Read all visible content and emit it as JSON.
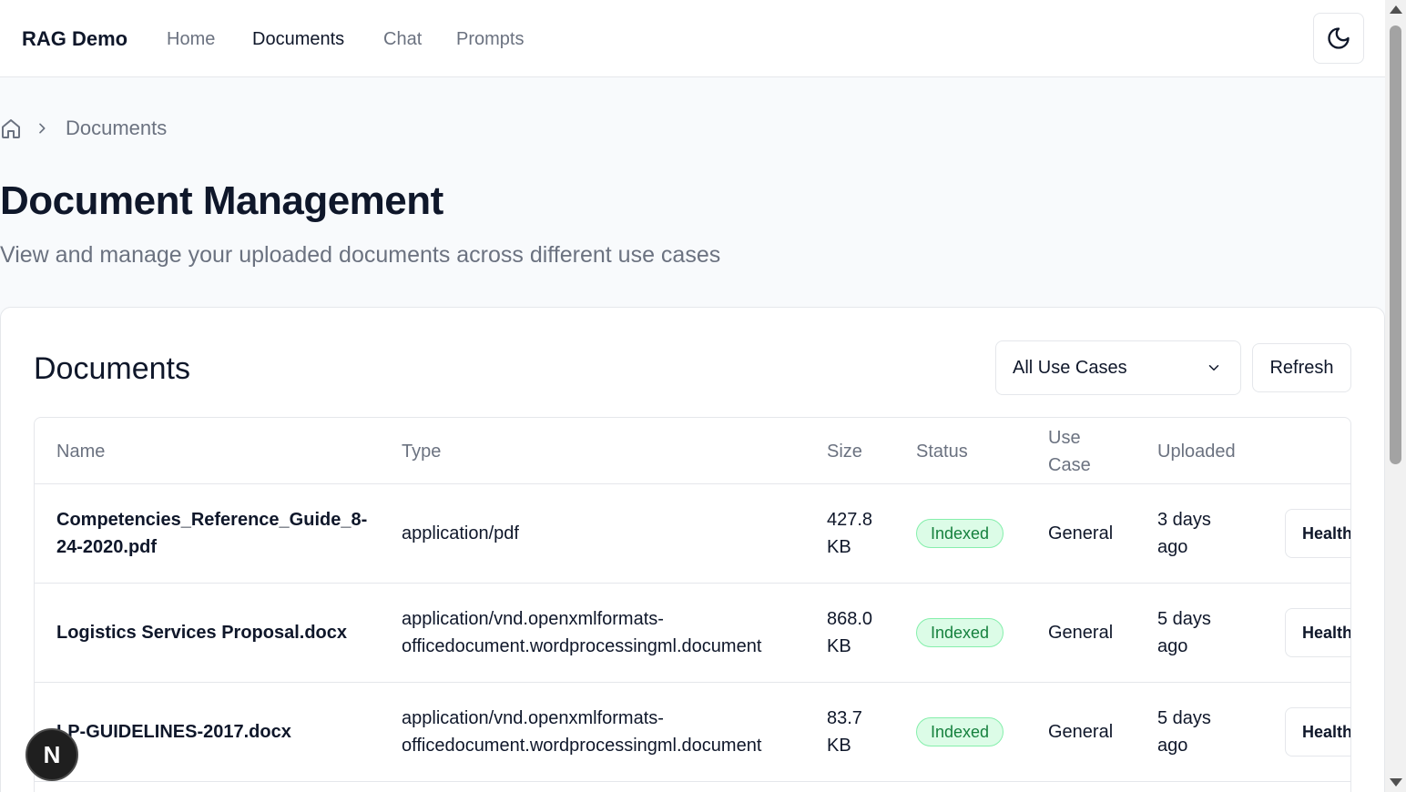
{
  "navbar": {
    "brand": "RAG Demo",
    "links": [
      {
        "label": "Home",
        "active": false
      },
      {
        "label": "Documents",
        "active": true
      },
      {
        "label": "Chat",
        "active": false
      },
      {
        "label": "Prompts",
        "active": false
      }
    ],
    "theme_toggle_icon": "moon-icon"
  },
  "breadcrumb": {
    "home_icon": "home-icon",
    "separator_icon": "chevron-right-icon",
    "current": "Documents"
  },
  "header": {
    "title": "Document Management",
    "subtitle": "View and manage your uploaded documents across different use cases"
  },
  "card": {
    "title": "Documents",
    "filter": {
      "selected": "All Use Cases",
      "icon": "chevron-down-icon"
    },
    "refresh_label": "Refresh"
  },
  "table": {
    "columns": [
      "Name",
      "Type",
      "Size",
      "Status",
      "Use Case",
      "Uploaded"
    ],
    "rows": [
      {
        "name": "Competencies_Reference_Guide_8-24-2020.pdf",
        "type": "application/pdf",
        "size": "427.8 KB",
        "status": "Indexed",
        "use_case": "General",
        "uploaded": "3 days ago",
        "action": "Health"
      },
      {
        "name": "Logistics Services Proposal.docx",
        "type": "application/vnd.openxmlformats-officedocument.wordprocessingml.document",
        "size": "868.0 KB",
        "status": "Indexed",
        "use_case": "General",
        "uploaded": "5 days ago",
        "action": "Health"
      },
      {
        "name": "LP-GUIDELINES-2017.docx",
        "type": "application/vnd.openxmlformats-officedocument.wordprocessingml.document",
        "size": "83.7 KB",
        "status": "Indexed",
        "use_case": "General",
        "uploaded": "5 days ago",
        "action": "Health"
      }
    ]
  },
  "fab": {
    "label": "N"
  },
  "colors": {
    "status_indexed_bg": "#dcfce7",
    "status_indexed_text": "#15803d",
    "text_primary": "#0f172a",
    "text_muted": "#6b7280"
  }
}
